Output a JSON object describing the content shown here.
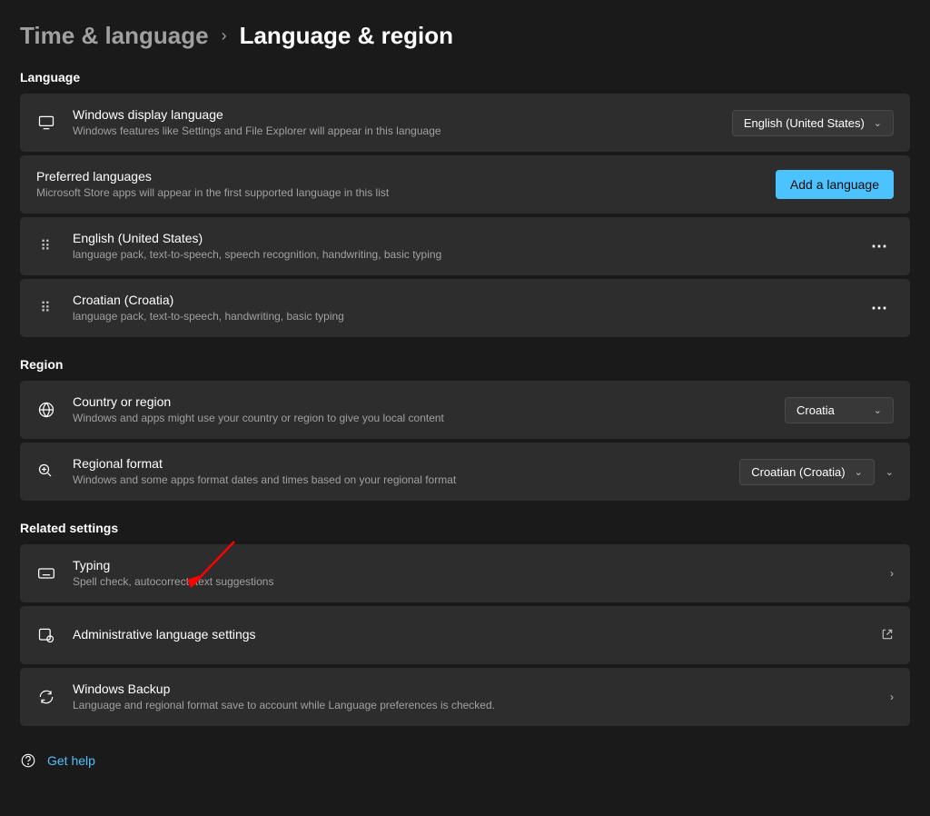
{
  "breadcrumb": {
    "parent": "Time & language",
    "separator": "›",
    "current": "Language & region"
  },
  "sections": {
    "language": {
      "title": "Language",
      "display_language": {
        "title": "Windows display language",
        "subtitle": "Windows features like Settings and File Explorer will appear in this language",
        "selected": "English (United States)"
      },
      "preferred": {
        "title": "Preferred languages",
        "subtitle": "Microsoft Store apps will appear in the first supported language in this list",
        "add_button": "Add a language",
        "items": [
          {
            "name": "English (United States)",
            "features": "language pack, text-to-speech, speech recognition, handwriting, basic typing"
          },
          {
            "name": "Croatian (Croatia)",
            "features": "language pack, text-to-speech, handwriting, basic typing"
          }
        ]
      }
    },
    "region": {
      "title": "Region",
      "country": {
        "title": "Country or region",
        "subtitle": "Windows and apps might use your country or region to give you local content",
        "selected": "Croatia"
      },
      "format": {
        "title": "Regional format",
        "subtitle": "Windows and some apps format dates and times based on your regional format",
        "selected": "Croatian (Croatia)"
      }
    },
    "related": {
      "title": "Related settings",
      "typing": {
        "title": "Typing",
        "subtitle": "Spell check, autocorrect, text suggestions"
      },
      "admin": {
        "title": "Administrative language settings"
      },
      "backup": {
        "title": "Windows Backup",
        "subtitle": "Language and regional format save to account while Language preferences is checked."
      }
    }
  },
  "footer": {
    "help": "Get help"
  }
}
